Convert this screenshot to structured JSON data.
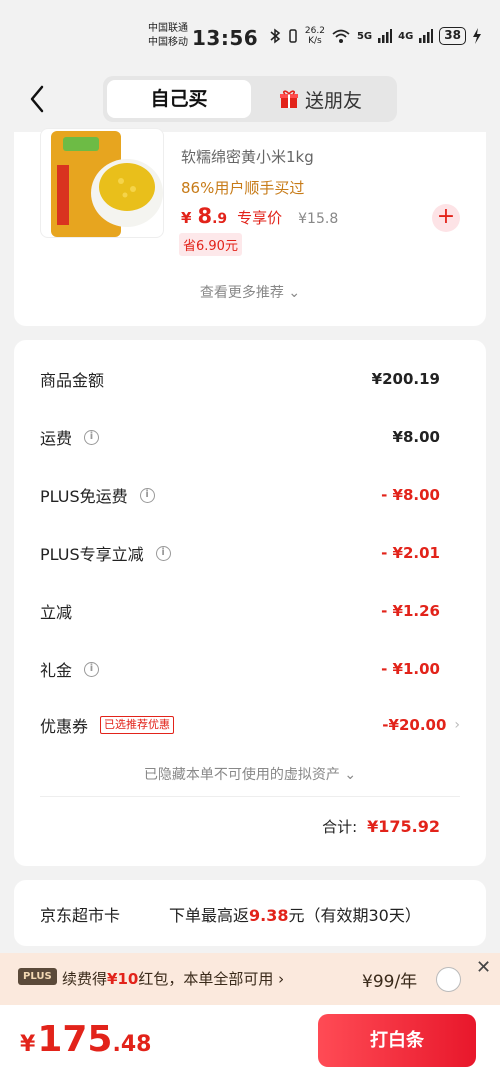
{
  "status_bar": {
    "carrier1": "中国联通",
    "carrier2": "中国移动",
    "time": "13:56",
    "speed_value": "26.2",
    "speed_unit": "K/s",
    "battery": "38",
    "net1": "5G",
    "net2": "4G"
  },
  "header": {
    "tab_self": "自己买",
    "tab_gift": "送朋友"
  },
  "product": {
    "name": "软糯绵密黄小米1kg",
    "repurchase": "86%用户顺手买过",
    "price_symbol": "¥",
    "price_int": "8",
    "price_dec": ".9",
    "price_tag": "专享价",
    "orig_price": "¥15.8",
    "save": "省6.90元",
    "more": "查看更多推荐"
  },
  "summary": {
    "rows": [
      {
        "label": "商品金额",
        "value": "¥200.19"
      },
      {
        "label": "运费",
        "value": "¥8.00"
      },
      {
        "label": "PLUS免运费",
        "value": "- ¥8.00"
      },
      {
        "label": "PLUS专享立减",
        "value": "- ¥2.01"
      },
      {
        "label": "立减",
        "value": "- ¥1.26"
      },
      {
        "label": "礼金",
        "value": "- ¥1.00"
      },
      {
        "label": "优惠券",
        "value": "-¥20.00",
        "tag": "已选推荐优惠"
      }
    ],
    "hidden_note": "已隐藏本单不可使用的虚拟资产",
    "total_label": "合计:",
    "total_value": "¥175.92"
  },
  "jd_card": {
    "label": "京东超市卡",
    "text_prefix": "下单最高返",
    "amount": "9.38",
    "text_suffix": "元（有效期30天）"
  },
  "plus_banner": {
    "badge": "PLUS",
    "text_prefix": "续费得",
    "highlight": "¥10",
    "text_suffix": "红包，本单全部可用 ›",
    "price": "¥99/年"
  },
  "bottom": {
    "yen": "¥",
    "int": "175",
    "dec": ".48",
    "pay_button": "打白条"
  },
  "colors": {
    "accent": "#e2231a",
    "background": "#f2f2f2"
  }
}
